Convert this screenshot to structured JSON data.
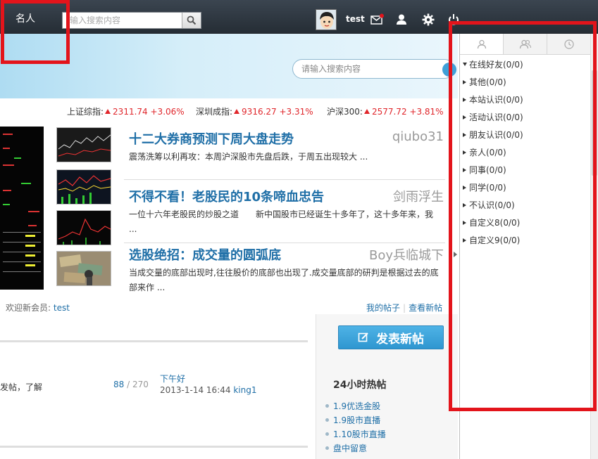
{
  "topbar": {
    "brand": "名人",
    "search_placeholder": "输入搜索内容",
    "username": "test"
  },
  "banner": {
    "search_placeholder": "请输入搜索内容"
  },
  "indices": [
    {
      "label": "上证综指:",
      "value": "2311.74",
      "change": "+3.06%"
    },
    {
      "label": "深圳成指:",
      "value": "9316.27",
      "change": "+3.31%"
    },
    {
      "label": "沪深300:",
      "value": "2577.72",
      "change": "+3.81%"
    }
  ],
  "articles": [
    {
      "title": "十二大券商预测下周大盘走势",
      "author": "qiubo31",
      "desc": "震荡洗筹以利再攻：本周沪深股市先盘后跌，于周五出现较大 ..."
    },
    {
      "title": "不得不看！老股民的10条啼血忠告",
      "author": "剑雨浮生",
      "desc": "一位十六年老股民的炒股之道　　新中国股市已经诞生十多年了，这十多年来，我 ..."
    },
    {
      "title": "选股绝招：成交量的圆弧底",
      "author": "Boy兵临城下",
      "desc": "当成交量的底部出现时,往往股价的底部也出现了.成交量底部的研判是根据过去的底部来作 ..."
    }
  ],
  "welcome": {
    "prefix": "欢迎新会员:",
    "user": "test"
  },
  "links": {
    "my_posts": "我的帖子",
    "new_posts": "查看新帖"
  },
  "post_row": {
    "preview": "发帖，了解",
    "replies": "88",
    "slash": "/",
    "views": "270",
    "last_title": "下午好",
    "last_time": "2013-1-14 16:44",
    "last_user": "king1"
  },
  "sidebar": {
    "post_button": "发表新帖",
    "hot_title": "24小时热帖",
    "hot_items": [
      "1.9优选金股",
      "1.9股市直播",
      "1.10股市直播",
      "盘中留意"
    ]
  },
  "buddy_panel": {
    "tabs": [
      "user-icon",
      "group-icon",
      "clock-icon"
    ],
    "groups": [
      "在线好友(0/0)",
      "其他(0/0)",
      "本站认识(0/0)",
      "活动认识(0/0)",
      "朋友认识(0/0)",
      "亲人(0/0)",
      "同事(0/0)",
      "同学(0/0)",
      "不认识(0/0)",
      "自定义8(0/0)",
      "自定义9(0/0)"
    ]
  },
  "colors": {
    "link_blue": "#1f6fa7",
    "up_red": "#e0262b",
    "highlight_red": "#e3141b",
    "topbar_dark": "#2b333b"
  }
}
